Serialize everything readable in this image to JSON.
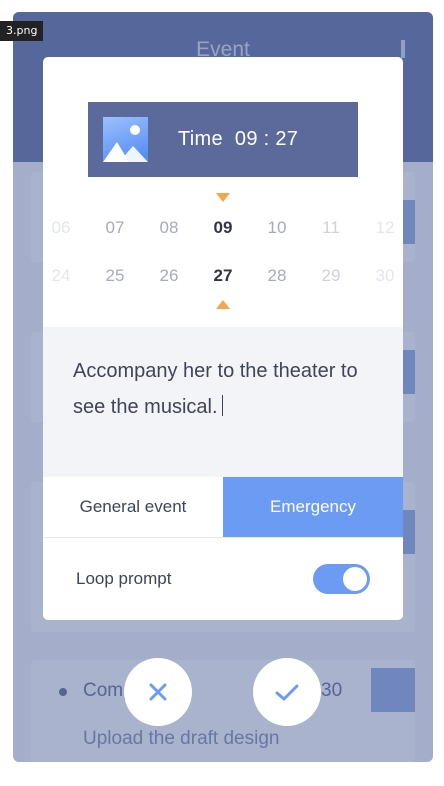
{
  "file_tag": "3.png",
  "background": {
    "header_title": "Event",
    "card_partial_title": "Comp",
    "card_partial_time": "30",
    "card_partial_subtitle": "Upload the draft design"
  },
  "time_banner": {
    "label": "Time",
    "value": "09 : 27"
  },
  "picker": {
    "hours": [
      "06",
      "07",
      "08",
      "09",
      "10",
      "11",
      "12"
    ],
    "selected_hour": "09",
    "minutes": [
      "24",
      "25",
      "26",
      "27",
      "28",
      "29",
      "30"
    ],
    "selected_minute": "27"
  },
  "note": {
    "text": "Accompany her to the theater to see the musical."
  },
  "event_type": {
    "options": [
      "General event",
      "Emergency"
    ],
    "selected": "Emergency"
  },
  "loop_prompt": {
    "label": "Loop prompt",
    "enabled": true
  },
  "colors": {
    "accent": "#6c9bf3",
    "banner": "#5b6a9a",
    "marker": "#f5a54b",
    "text": "#3f4556"
  },
  "icons": {
    "banner": "image-icon",
    "cancel": "close-icon",
    "confirm": "check-icon"
  }
}
